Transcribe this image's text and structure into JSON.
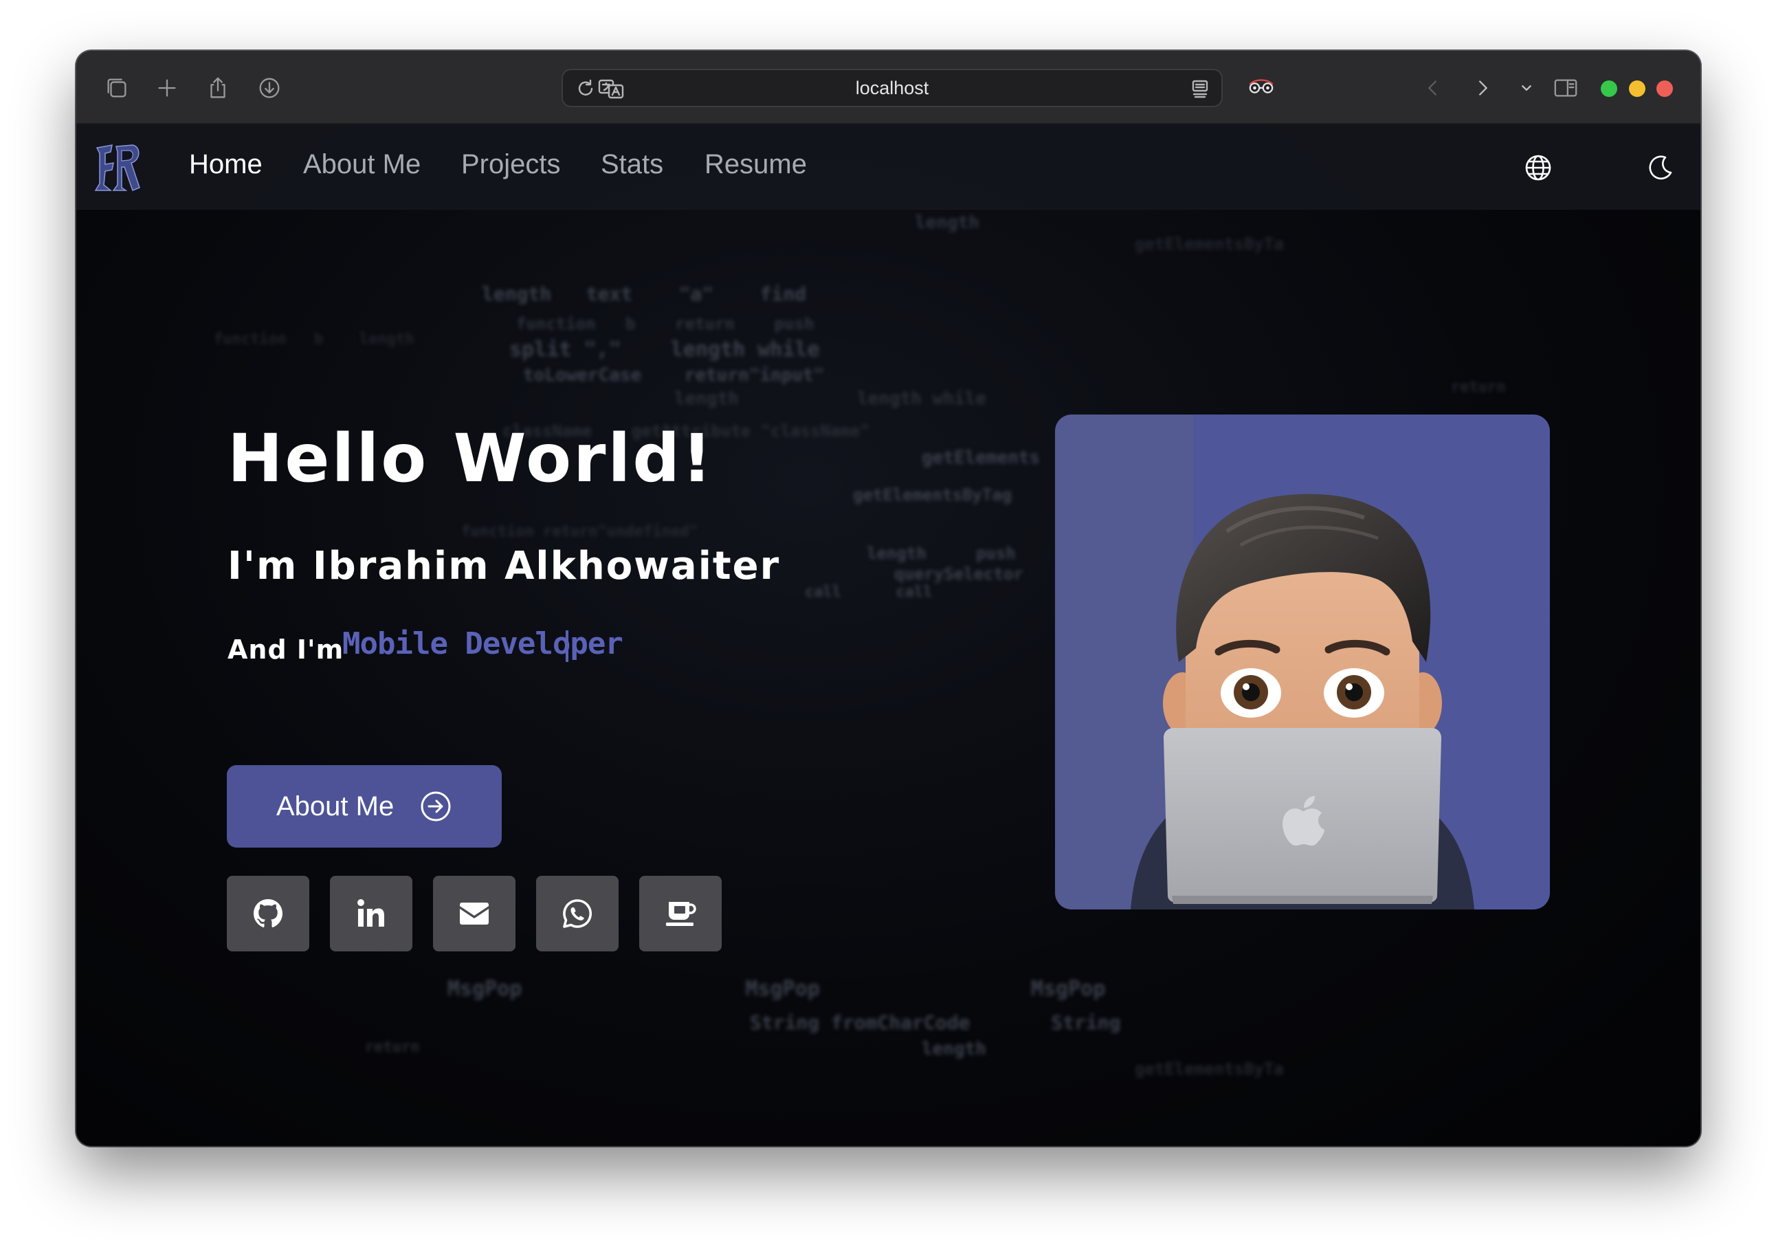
{
  "browser": {
    "url": "localhost"
  },
  "navbar": {
    "links": [
      "Home",
      "About Me",
      "Projects",
      "Stats",
      "Resume"
    ],
    "active": "Home"
  },
  "hero": {
    "greeting": "Hello World!",
    "intro": "I'm Ibrahim Alkhowaiter",
    "role_prefix": "And I'm",
    "role": "Mobile Developer",
    "cta_label": "About Me"
  },
  "social": [
    "github-icon",
    "linkedin-icon",
    "email-icon",
    "whatsapp-icon",
    "coffee-icon"
  ],
  "colors": {
    "accent": "#4d5396",
    "role_text": "#5a62b8",
    "avatar_bg": "#4f579a",
    "social_bg": "#4a4a4e"
  }
}
